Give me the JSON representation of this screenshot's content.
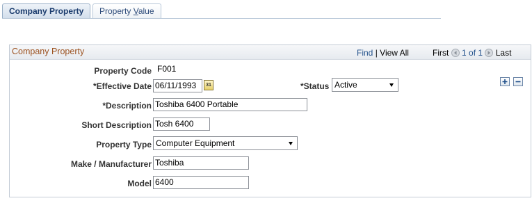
{
  "tabs": {
    "active": "Company Property",
    "inactive_prefix": "Property ",
    "inactive_underlined": "V",
    "inactive_suffix": "alue"
  },
  "section": {
    "title": "Company Property",
    "find": "Find",
    "view_all": "View All",
    "first": "First",
    "range": "1 of 1",
    "last": "Last",
    "pipe": "|"
  },
  "form": {
    "property_code_label": "Property Code",
    "property_code_value": "F001",
    "effective_date_label": "*Effective Date",
    "effective_date_value": "06/11/1993",
    "calendar_text": "31",
    "status_label": "*Status",
    "status_value": "Active",
    "description_label": "*Description",
    "description_value": "Toshiba 6400 Portable",
    "short_description_label": "Short Description",
    "short_description_value": "Tosh 6400",
    "property_type_label": "Property Type",
    "property_type_value": "Computer Equipment",
    "make_label": "Make / Manufacturer",
    "make_value": "Toshiba",
    "model_label": "Model",
    "model_value": "6400"
  },
  "colors": {
    "title": "#9c5220",
    "link": "#1f4f8a",
    "tab_text": "#1a3b6d"
  },
  "icons": [
    "prev-icon",
    "next-icon",
    "calendar-icon",
    "add-row-icon",
    "delete-row-icon",
    "dropdown-arrow-icon"
  ]
}
